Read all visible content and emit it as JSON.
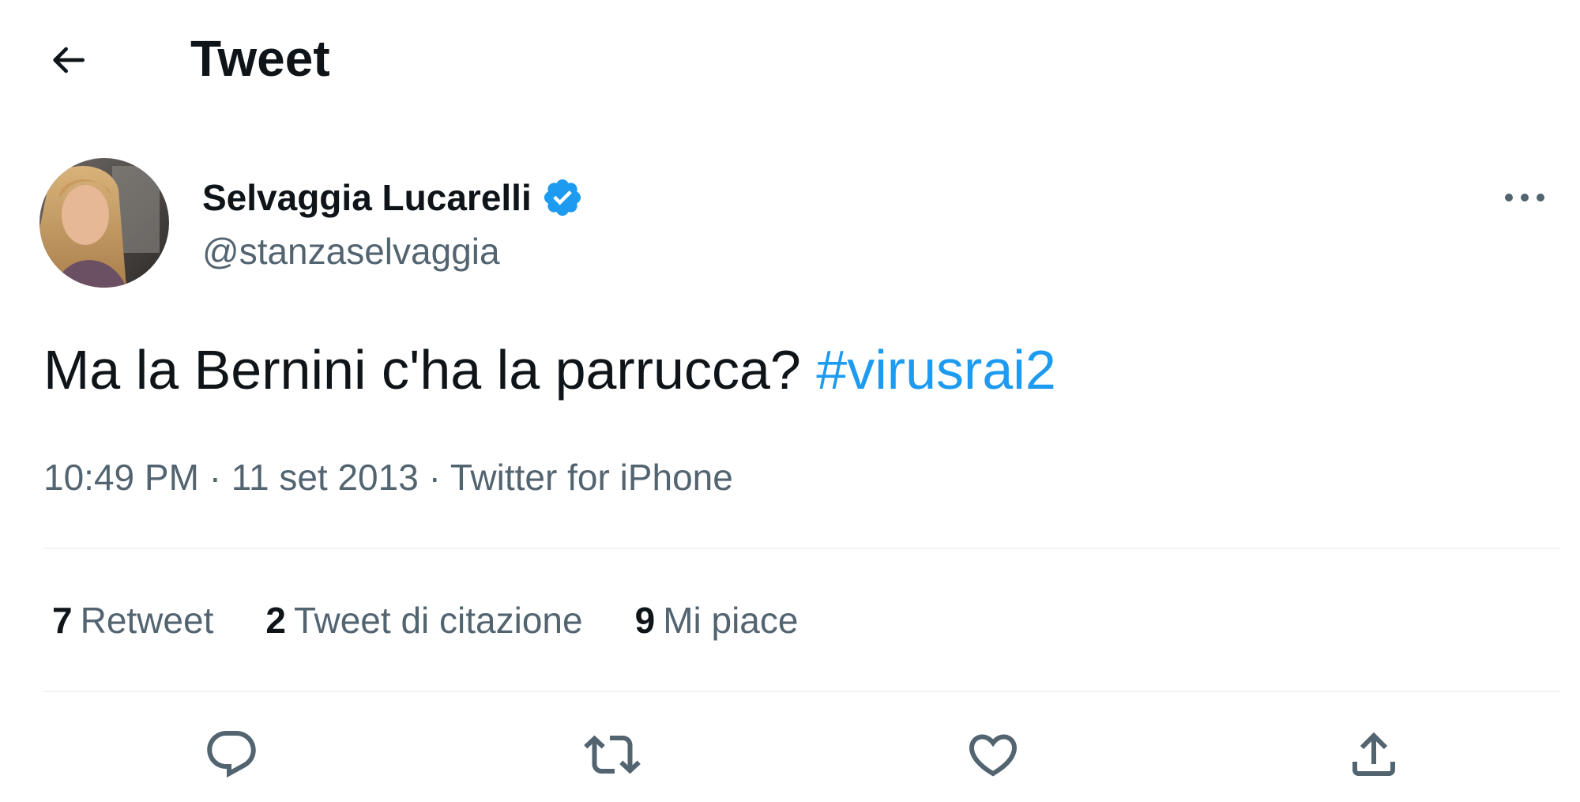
{
  "header": {
    "back_icon": "arrow-left-icon",
    "title": "Tweet"
  },
  "tweet": {
    "author": {
      "display_name": "Selvaggia Lucarelli",
      "verified_icon": "verified-badge-icon",
      "handle": "@stanzaselvaggia"
    },
    "more_icon": "ellipsis-icon",
    "text": "Ma la Bernini c'ha la parrucca?",
    "hashtag": "#virusrai2",
    "time": "10:49 PM",
    "separator": "·",
    "date": "11 set 2013",
    "source": "Twitter for iPhone"
  },
  "stats": {
    "retweets": {
      "count": "7",
      "label": "Retweet"
    },
    "quotes": {
      "count": "2",
      "label": "Tweet di citazione"
    },
    "likes": {
      "count": "9",
      "label": "Mi piace"
    }
  },
  "actions": [
    {
      "icon": "reply-icon"
    },
    {
      "icon": "retweet-icon"
    },
    {
      "icon": "like-icon"
    },
    {
      "icon": "share-icon"
    }
  ],
  "colors": {
    "text": "#0f1419",
    "secondary": "#536471",
    "accent": "#1d9bf0",
    "divider": "#eff3f4"
  }
}
